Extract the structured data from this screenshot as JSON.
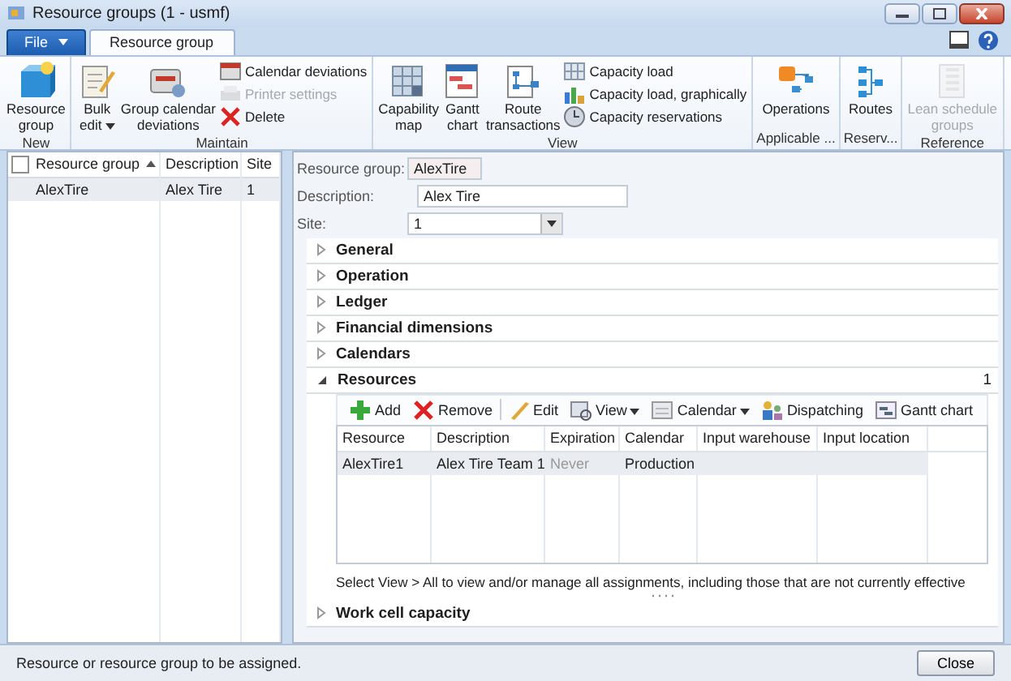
{
  "window": {
    "title": "Resource groups (1 - usmf)"
  },
  "ribbon": {
    "file_menu": {
      "label": "File"
    },
    "tabs": [
      {
        "label": "Resource group",
        "selected": true
      }
    ],
    "groups": [
      {
        "label": "New",
        "items": [
          {
            "label": "Resource\ngroup",
            "kind": "large",
            "disabled": false,
            "dropdown": false
          }
        ]
      },
      {
        "label": "Maintain",
        "items": [
          {
            "label": "Bulk\nedit",
            "kind": "large",
            "disabled": false,
            "dropdown": true
          },
          {
            "label": "Group calendar\ndeviations",
            "kind": "large",
            "disabled": false,
            "dropdown": false
          },
          {
            "label": "Calendar deviations",
            "kind": "small",
            "disabled": false,
            "dropdown": false
          },
          {
            "label": "Printer settings",
            "kind": "small",
            "disabled": true,
            "dropdown": false
          },
          {
            "label": "Delete",
            "kind": "small",
            "disabled": false,
            "dropdown": false
          }
        ]
      },
      {
        "label": "View",
        "items": [
          {
            "label": "Capability\nmap",
            "kind": "large",
            "disabled": false,
            "dropdown": false
          },
          {
            "label": "Gantt\nchart",
            "kind": "large",
            "disabled": false,
            "dropdown": false
          },
          {
            "label": "Route\ntransactions",
            "kind": "large",
            "disabled": false,
            "dropdown": false
          },
          {
            "label": "Capacity load",
            "kind": "small",
            "disabled": false,
            "dropdown": false
          },
          {
            "label": "Capacity load, graphically",
            "kind": "small",
            "disabled": false,
            "dropdown": false
          },
          {
            "label": "Capacity reservations",
            "kind": "small",
            "disabled": false,
            "dropdown": false
          }
        ]
      },
      {
        "label": "Applicable ...",
        "items": [
          {
            "label": "Operations",
            "kind": "large",
            "disabled": false,
            "dropdown": false
          }
        ]
      },
      {
        "label": "Reserv...",
        "items": [
          {
            "label": "Routes",
            "kind": "large",
            "disabled": false,
            "dropdown": false
          }
        ]
      },
      {
        "label": "Reference",
        "items": [
          {
            "label": "Lean schedule\ngroups",
            "kind": "large",
            "disabled": true,
            "dropdown": false
          }
        ]
      }
    ]
  },
  "list": {
    "select_all": {
      "checked": false
    },
    "columns": [
      {
        "label": "Resource group",
        "sorted": true
      },
      {
        "label": "Description",
        "sorted": false
      },
      {
        "label": "Site",
        "sorted": false
      }
    ],
    "rows": [
      {
        "cells": [
          "AlexTire",
          "Alex Tire",
          "1"
        ],
        "selected": true
      }
    ]
  },
  "form": {
    "fields": [
      {
        "label": "Resource group:",
        "value": "AlexTire",
        "kind": "readonly"
      },
      {
        "label": "Description:",
        "value": "Alex Tire",
        "kind": "text"
      },
      {
        "label": "Site:",
        "value": "1",
        "kind": "dropdown"
      }
    ],
    "sections": [
      {
        "title": "General",
        "expanded": false
      },
      {
        "title": "Operation",
        "expanded": false
      },
      {
        "title": "Ledger",
        "expanded": false
      },
      {
        "title": "Financial dimensions",
        "expanded": false
      },
      {
        "title": "Calendars",
        "expanded": false
      },
      {
        "title": "Resources",
        "expanded": true,
        "count": "1",
        "toolbar": [
          {
            "label": "Add",
            "dropdown": false
          },
          {
            "label": "Remove",
            "dropdown": false
          },
          {
            "label": "Edit",
            "dropdown": false
          },
          {
            "label": "View",
            "dropdown": true
          },
          {
            "label": "Calendar",
            "dropdown": true
          },
          {
            "label": "Dispatching",
            "dropdown": false
          },
          {
            "label": "Gantt chart",
            "dropdown": false
          }
        ],
        "columns": [
          "Resource",
          "Description",
          "Expiration",
          "Calendar",
          "Input warehouse",
          "Input location"
        ],
        "rows": [
          {
            "cells": [
              {
                "text": "AlexTire1",
                "disabled": false
              },
              {
                "text": "Alex Tire Team 1",
                "disabled": false
              },
              {
                "text": "Never",
                "disabled": true
              },
              {
                "text": "Production",
                "disabled": false
              }
            ],
            "selected": true
          }
        ],
        "note": "Select View > All to view and/or manage all assignments, including those that are not currently effective"
      },
      {
        "title": "Work cell capacity",
        "expanded": false
      }
    ]
  },
  "status_bar": {
    "text": "Resource or resource group to be assigned.",
    "button": "Close"
  }
}
